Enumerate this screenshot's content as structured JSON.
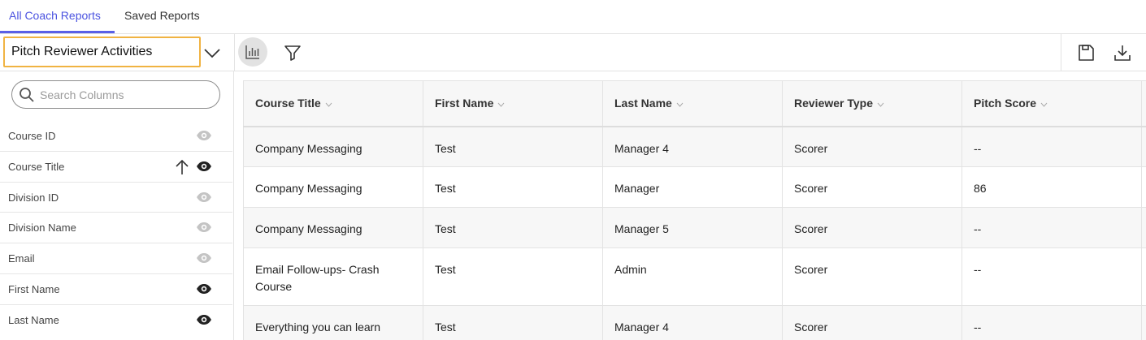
{
  "tabs": [
    {
      "label": "All Coach Reports",
      "active": true
    },
    {
      "label": "Saved Reports",
      "active": false
    }
  ],
  "toolbar": {
    "report_name": "Pitch Reviewer Activities",
    "icons": [
      "chevron-down-icon",
      "bar-chart-icon",
      "filter-icon",
      "save-icon",
      "download-icon"
    ]
  },
  "sidebar": {
    "search_placeholder": "Search Columns",
    "columns": [
      {
        "label": "Course ID",
        "visible": false,
        "sorted": false
      },
      {
        "label": "Course Title",
        "visible": true,
        "sorted": true
      },
      {
        "label": "Division ID",
        "visible": false,
        "sorted": false
      },
      {
        "label": "Division Name",
        "visible": false,
        "sorted": false
      },
      {
        "label": "Email",
        "visible": false,
        "sorted": false
      },
      {
        "label": "First Name",
        "visible": true,
        "sorted": false
      },
      {
        "label": "Last Name",
        "visible": true,
        "sorted": false
      }
    ]
  },
  "table": {
    "headers": [
      "Course Title",
      "First Name",
      "Last Name",
      "Reviewer Type",
      "Pitch Score"
    ],
    "rows": [
      [
        "Company Messaging",
        "Test",
        "Manager 4",
        "Scorer",
        "--"
      ],
      [
        "Company Messaging",
        "Test",
        "Manager",
        "Scorer",
        "86"
      ],
      [
        "Company Messaging",
        "Test",
        "Manager 5",
        "Scorer",
        "--"
      ],
      [
        "Email Follow-ups- Crash Course",
        "Test",
        "Admin",
        "Scorer",
        "--"
      ],
      [
        "Everything you can learn",
        "Test",
        "Manager 4",
        "Scorer",
        "--"
      ]
    ]
  },
  "colors": {
    "accent": "#5a60e6",
    "highlight_border": "#f0b342",
    "eye_active": "#222222",
    "eye_inactive": "#c4c4c4"
  }
}
